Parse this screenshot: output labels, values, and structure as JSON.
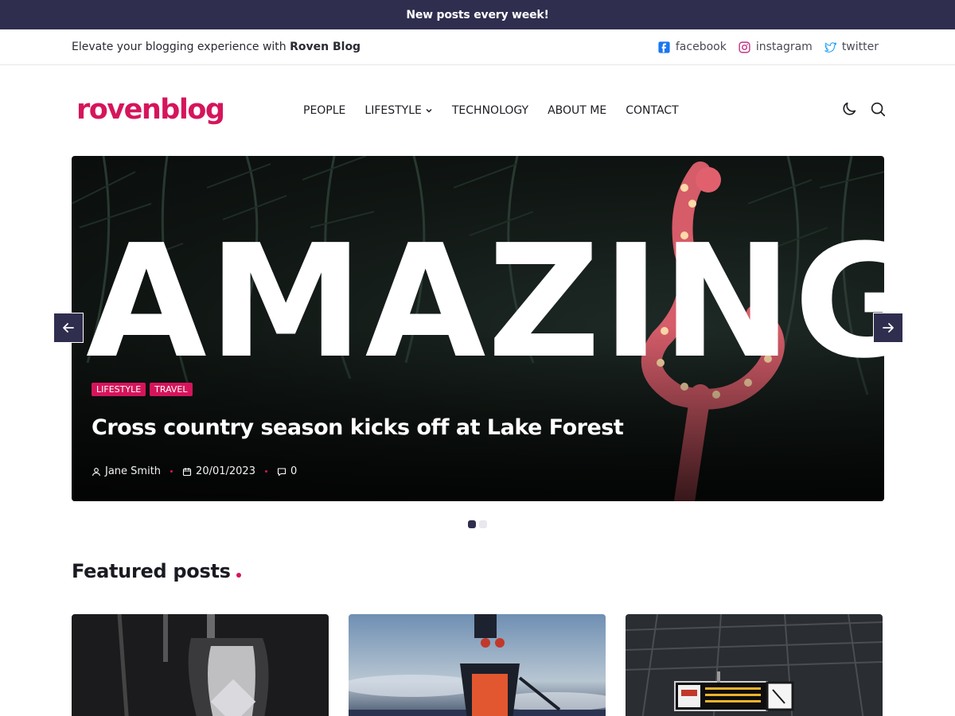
{
  "announcement": "New posts every week!",
  "topbar": {
    "tagline_prefix": "Elevate your blogging experience with ",
    "tagline_brand": "Roven Blog",
    "social": [
      {
        "label": "facebook",
        "icon": "facebook-icon",
        "color": "#1877f2"
      },
      {
        "label": "instagram",
        "icon": "instagram-icon",
        "color": "#c13584"
      },
      {
        "label": "twitter",
        "icon": "twitter-icon",
        "color": "#1da1f2"
      }
    ]
  },
  "header": {
    "logo": "rovenblog",
    "nav": [
      "PEOPLE",
      "LIFESTYLE",
      "TECHNOLOGY",
      "ABOUT ME",
      "CONTACT"
    ],
    "icons": [
      "moon-icon",
      "search-icon"
    ]
  },
  "hero": {
    "word": "AMAZING",
    "tags": [
      "LIFESTYLE",
      "TRAVEL"
    ],
    "title": "Cross country season kicks off at Lake Forest",
    "author": "Jane Smith",
    "date": "20/01/2023",
    "comments": "0",
    "slides": 2,
    "active_slide": 1
  },
  "featured": {
    "title": "Featured posts"
  },
  "colors": {
    "accent": "#d5155b",
    "dark": "#2f2e4f"
  }
}
